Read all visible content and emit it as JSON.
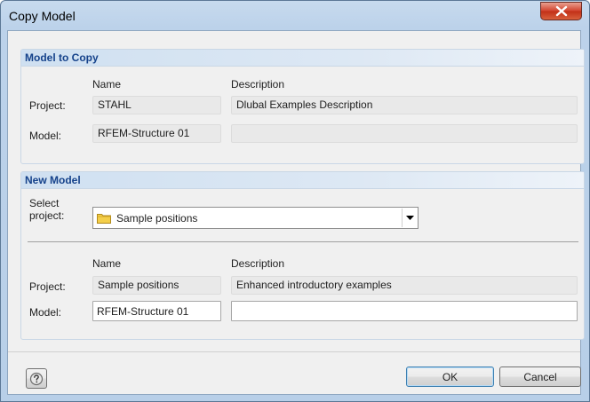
{
  "window": {
    "title": "Copy Model"
  },
  "model_to_copy": {
    "header": "Model to Copy",
    "col_name": "Name",
    "col_description": "Description",
    "project_label": "Project:",
    "model_label": "Model:",
    "project_name": "STAHL",
    "project_description": "Dlubal Examples Description",
    "model_name": "RFEM-Structure 01",
    "model_description": ""
  },
  "new_model": {
    "header": "New Model",
    "select_project_label_line1": "Select",
    "select_project_label_line2": "project:",
    "selected_project": "Sample positions",
    "col_name": "Name",
    "col_description": "Description",
    "project_label": "Project:",
    "model_label": "Model:",
    "project_name": "Sample positions",
    "project_description": "Enhanced introductory examples",
    "model_name_value": "RFEM-Structure 01",
    "model_description_value": ""
  },
  "buttons": {
    "ok": "OK",
    "cancel": "Cancel"
  },
  "icons": {
    "close": "close-icon",
    "folder": "folder-icon",
    "help": "help-icon",
    "dropdown": "chevron-down-icon"
  },
  "colors": {
    "accent": "#15428b",
    "close_button": "#c23018"
  }
}
